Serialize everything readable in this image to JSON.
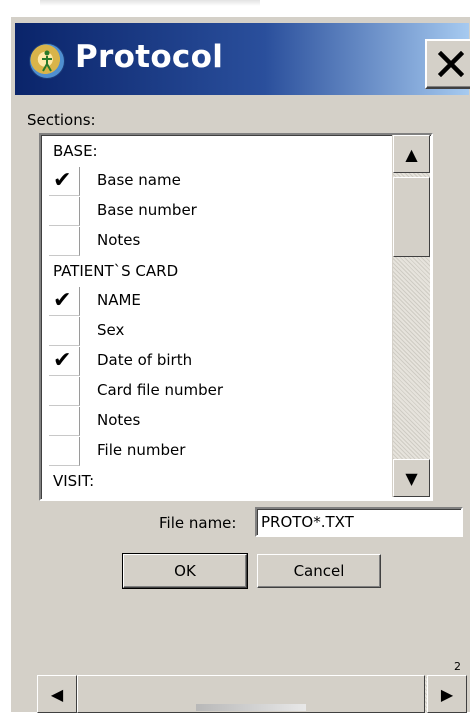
{
  "window": {
    "title": "Protocol",
    "close_label": "✕"
  },
  "sections": {
    "label": "Sections:",
    "groups": [
      {
        "header": "BASE:",
        "items": [
          {
            "label": "Base name",
            "checked": true
          },
          {
            "label": "Base number",
            "checked": false
          },
          {
            "label": "Notes",
            "checked": false
          }
        ]
      },
      {
        "header": "PATIENT`S CARD",
        "items": [
          {
            "label": "NAME",
            "checked": true
          },
          {
            "label": "Sex",
            "checked": false
          },
          {
            "label": "Date of birth",
            "checked": true
          },
          {
            "label": "Card file number",
            "checked": false
          },
          {
            "label": "Notes",
            "checked": false
          },
          {
            "label": "File number",
            "checked": false
          }
        ]
      },
      {
        "header": "VISIT:",
        "items": []
      }
    ],
    "check_glyph": "✔"
  },
  "file": {
    "label": "File name:",
    "value": "PROTO*.TXT"
  },
  "buttons": {
    "ok": "OK",
    "cancel": "Cancel"
  },
  "scroll": {
    "up": "▲",
    "down": "▼",
    "left": "◀",
    "right": "▶"
  },
  "edge_text": "2"
}
